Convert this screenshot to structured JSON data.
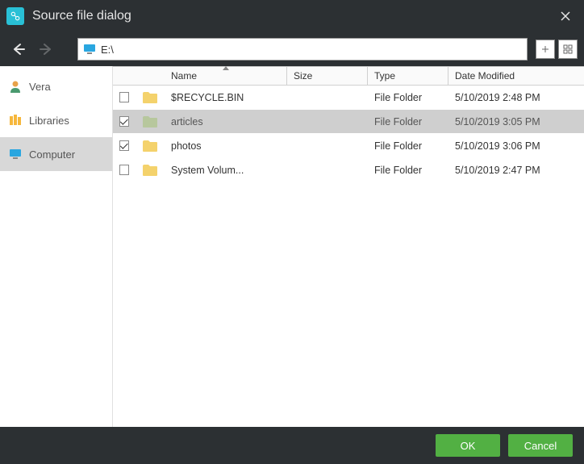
{
  "title": "Source file dialog",
  "path": "E:\\",
  "sidebar": {
    "items": [
      {
        "label": "Vera",
        "icon": "user-icon"
      },
      {
        "label": "Libraries",
        "icon": "libraries-icon"
      },
      {
        "label": "Computer",
        "icon": "computer-icon"
      }
    ],
    "active_index": 2
  },
  "columns": {
    "name": "Name",
    "size": "Size",
    "type": "Type",
    "date": "Date Modified",
    "sorted_by": "name",
    "direction": "asc"
  },
  "files": [
    {
      "checked": false,
      "name": "$RECYCLE.BIN",
      "size": "",
      "type": "File Folder",
      "date": "5/10/2019 2:48 PM",
      "selected": false
    },
    {
      "checked": true,
      "name": "articles",
      "size": "",
      "type": "File Folder",
      "date": "5/10/2019 3:05 PM",
      "selected": true
    },
    {
      "checked": true,
      "name": "photos",
      "size": "",
      "type": "File Folder",
      "date": "5/10/2019 3:06 PM",
      "selected": false
    },
    {
      "checked": false,
      "name": "System Volum...",
      "size": "",
      "type": "File Folder",
      "date": "5/10/2019 2:47 PM",
      "selected": false
    }
  ],
  "buttons": {
    "ok": "OK",
    "cancel": "Cancel"
  },
  "colors": {
    "accent": "#52b043",
    "titlebar": "#2c3033",
    "folder": "#f4d26c",
    "folder_sel": "#b7c79d"
  }
}
